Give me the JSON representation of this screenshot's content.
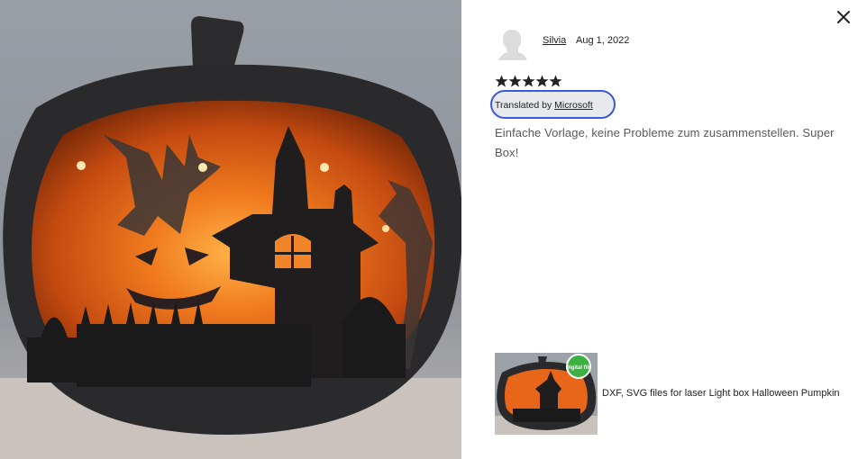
{
  "review": {
    "reviewer_name": "Silvia",
    "date": "Aug 1, 2022",
    "rating": 5,
    "rating_max": 5,
    "translated_prefix": "Translated by ",
    "translated_provider": "Microsoft",
    "text": "Einfache Vorlage, keine Probleme zum zusammenstellen. Super Box!"
  },
  "listing": {
    "title": "DXF, SVG files for laser Light box Halloween Pumpkin"
  },
  "icons": {
    "close": "close-icon",
    "avatar": "default-avatar-icon",
    "star": "star-icon"
  },
  "colors": {
    "focus_ring": "#3a5bd6",
    "text_primary": "#222222",
    "text_secondary": "#595959",
    "pumpkin_glow": "#e8661a"
  }
}
